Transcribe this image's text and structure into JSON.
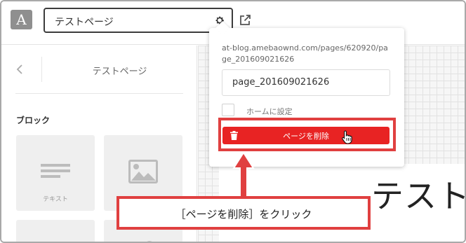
{
  "header": {
    "logo_letter": "A",
    "page_name": "テストページ",
    "settings_icon": "gear-icon",
    "open_icon": "external-link-icon"
  },
  "sidebar": {
    "back_icon": "chevron-left-icon",
    "title": "テストページ",
    "section_heading": "ブロック",
    "tiles": [
      {
        "label": "テキスト",
        "icon": "text-lines-icon"
      },
      {
        "label": "",
        "icon": "image-icon"
      }
    ]
  },
  "popover": {
    "url_text": "at-blog.amebaownd.com/pages/620920/page_201609021626",
    "slug_value": "page_201609021626",
    "home_label": "ホームに設定",
    "home_checked": false,
    "delete_label": "ページを削除",
    "delete_icon": "trash-icon",
    "delete_color": "#e82323"
  },
  "canvas": {
    "heading": "テスト"
  },
  "annotation": {
    "text": "［ページを削除］をクリック",
    "color": "#e04040"
  }
}
